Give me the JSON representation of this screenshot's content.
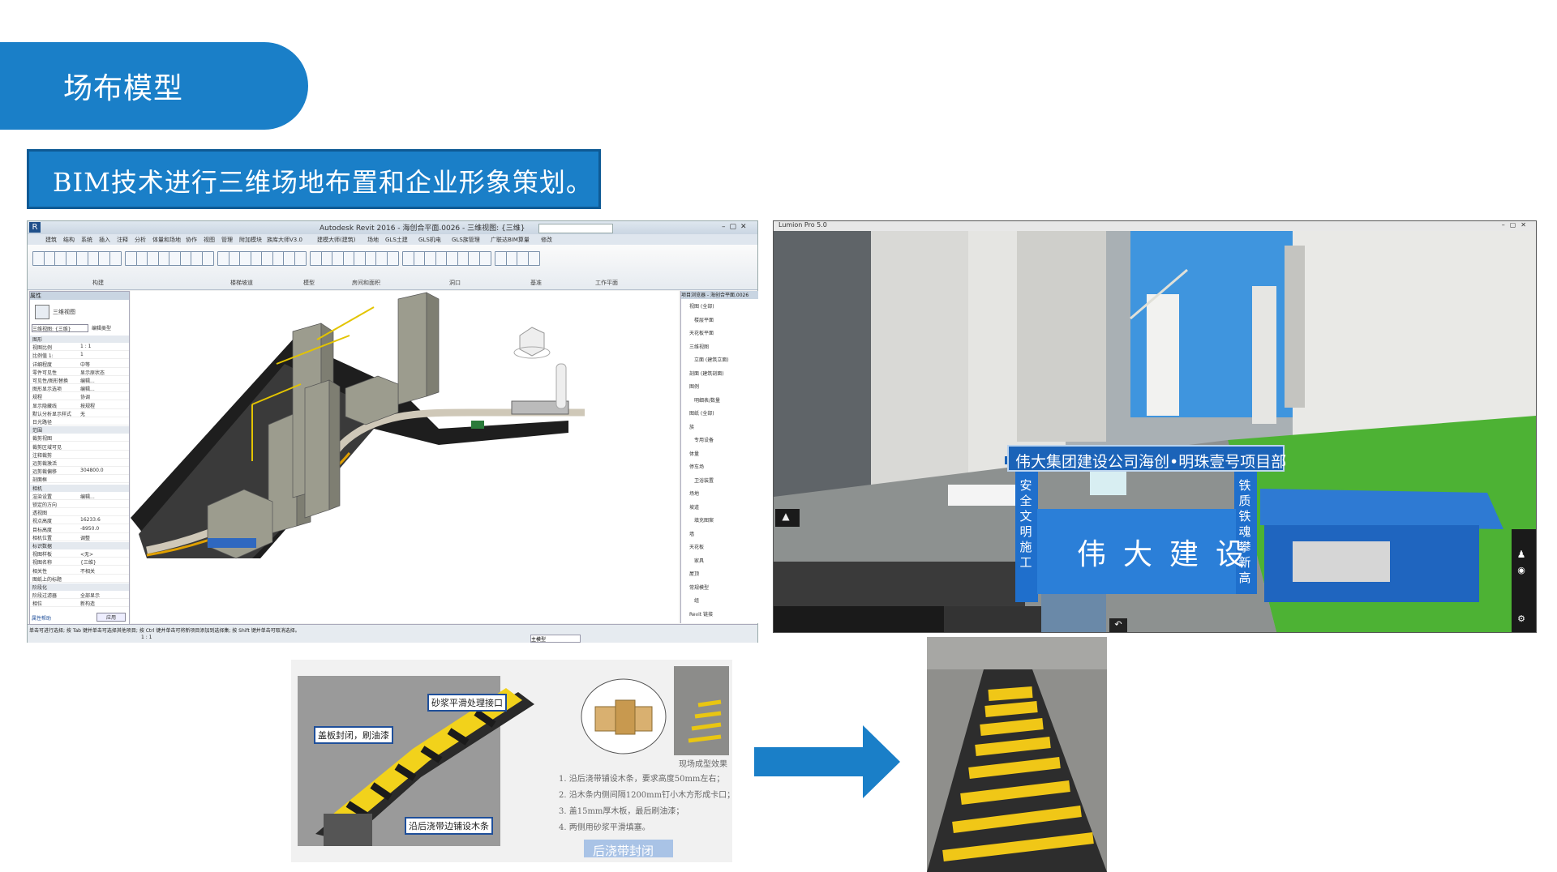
{
  "header": {
    "title": "场布模型"
  },
  "subtitle": "BIM技术进行三维场地布置和企业形象策划。",
  "revit": {
    "window_title": "Autodesk Revit 2016 -   海创合平面.0026 - 三维视图: {三维}",
    "tabs": [
      "建筑",
      "结构",
      "系统",
      "插入",
      "注释",
      "分析",
      "体量和场地",
      "协作",
      "视图",
      "管理",
      "附加模块",
      "族库大师V3.0",
      "建模大师(建筑)",
      "场地",
      "GLS土建",
      "GLS机电",
      "GLS族管理",
      "广联达BIM算量",
      "修改"
    ],
    "ribbon_groups": [
      "构建",
      "楼梯坡道",
      "模型",
      "房间和面积",
      "洞口",
      "基准",
      "工作平面"
    ],
    "properties_title": "属性",
    "view_type": "三维视图",
    "view_selector": "三维视图: {三维}",
    "edit_type": "编辑类型",
    "properties_rows": [
      {
        "label": "图形",
        "value": ""
      },
      {
        "label": "视图比例",
        "value": "1 : 1"
      },
      {
        "label": "比例值 1:",
        "value": "1"
      },
      {
        "label": "详细程度",
        "value": "中等"
      },
      {
        "label": "零件可见性",
        "value": "显示原状态"
      },
      {
        "label": "可见性/图形替换",
        "value": "编辑..."
      },
      {
        "label": "图形显示选项",
        "value": "编辑..."
      },
      {
        "label": "规程",
        "value": "协调"
      },
      {
        "label": "显示隐藏线",
        "value": "按规程"
      },
      {
        "label": "默认分析显示样式",
        "value": "无"
      },
      {
        "label": "日光路径",
        "value": ""
      },
      {
        "label": "范围",
        "value": ""
      },
      {
        "label": "裁剪视图",
        "value": ""
      },
      {
        "label": "裁剪区域可见",
        "value": ""
      },
      {
        "label": "注释裁剪",
        "value": ""
      },
      {
        "label": "远剪裁激活",
        "value": ""
      },
      {
        "label": "远剪裁偏移",
        "value": "304800.0"
      },
      {
        "label": "剖面框",
        "value": ""
      },
      {
        "label": "相机",
        "value": ""
      },
      {
        "label": "渲染设置",
        "value": "编辑..."
      },
      {
        "label": "锁定的方向",
        "value": ""
      },
      {
        "label": "透视图",
        "value": ""
      },
      {
        "label": "视点高度",
        "value": "16233.6"
      },
      {
        "label": "目标高度",
        "value": "-8950.0"
      },
      {
        "label": "相机位置",
        "value": "调整"
      },
      {
        "label": "标识数据",
        "value": ""
      },
      {
        "label": "视图样板",
        "value": "<无>"
      },
      {
        "label": "视图名称",
        "value": "{三维}"
      },
      {
        "label": "相关性",
        "value": "不相关"
      },
      {
        "label": "图纸上的标题",
        "value": ""
      },
      {
        "label": "阶段化",
        "value": ""
      },
      {
        "label": "阶段过滤器",
        "value": "全部显示"
      },
      {
        "label": "相位",
        "value": "新构造"
      }
    ],
    "properties_help": "属性帮助",
    "apply_button": "应用",
    "browser_title": "项目浏览器 - 海创合平面.0026",
    "browser_items": [
      "视图 (全部)",
      "楼层平面",
      "天花板平面",
      "三维视图",
      "立面 (建筑立面)",
      "剖面 (建筑剖面)",
      "图例",
      "明细表/数量",
      "图纸 (全部)",
      "族",
      "专用设备",
      "体量",
      "停车场",
      "卫浴装置",
      "场地",
      "坡道",
      "填充图案",
      "墙",
      "天花板",
      "家具",
      "屋顶",
      "常规模型",
      "组",
      "Revit 链接"
    ],
    "status_text": "单击可进行选择; 按 Tab 键并单击可选择其他项目; 按 Ctrl 键并单击可将新项目添加到选择集; 按 Shift 键并单击可取消选择。",
    "scale_label": "1 : 1",
    "model_label": "主模型"
  },
  "lumion": {
    "window_title": "Lumion Pro 5.0",
    "banner": "伟大集团建设公司海创•明珠壹号项目部",
    "gate_chars": [
      "伟",
      "大",
      "建",
      "设"
    ],
    "left_column": "安全文明施工",
    "right_column": "铁质铁魂攀新高"
  },
  "illustration": {
    "callout_top": "砂浆平滑处理接口",
    "callout_left": "盖板封闭，刷油漆",
    "callout_bottom": "沿后浇带边铺设木条",
    "photo_label": "现场成型效果",
    "notes": [
      "1. 沿后浇带铺设木条，要求高度50mm左右；",
      "2. 沿木条内侧间隔1200mm钉小木方形成卡口；",
      "3. 盖15mm厚木板，最后刷油漆；",
      "4. 两侧用砂浆平滑填塞。"
    ],
    "caption": "后浇带封闭"
  },
  "colors": {
    "brand_blue": "#1a7fc8",
    "dark_blue": "#0e5a95",
    "hazard_yellow": "#f2d21b"
  }
}
